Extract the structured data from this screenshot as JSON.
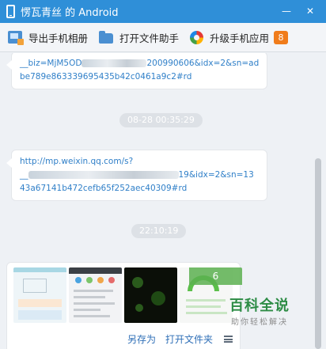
{
  "window": {
    "title": "愣瓦青丝 的 Android",
    "minimize_glyph": "—",
    "close_glyph": "✕"
  },
  "toolbar": {
    "export_label": "导出手机相册",
    "open_file_label": "打开文件助手",
    "upgrade_label": "升级手机应用",
    "upgrade_badge": "8"
  },
  "messages": {
    "msg1_line1_start": "__biz=MjM5OD",
    "msg1_line1_end": "200990606&idx=2&sn=ad",
    "msg1_line2": "be789e863339695435b42c0461a9c2#rd",
    "time1": "08-28 00:35:29",
    "msg2_line1": "http://mp.weixin.qq.com/s?",
    "msg2_line2_start": "__",
    "msg2_line2_end": "19&idx=2&sn=13",
    "msg2_line3": "43a67141b472cefb65f252aec40309#rd",
    "time2": "22:10:19"
  },
  "image_card": {
    "count_overlay": "6",
    "save_as": "另存为",
    "open_folder": "打开文件夹"
  },
  "watermark": {
    "main": "百科全说",
    "sub": "助你轻松解决"
  },
  "icons": [
    "phone-icon",
    "export-album-icon",
    "folder-icon",
    "upgrade-apps-icon",
    "menu-icon"
  ]
}
